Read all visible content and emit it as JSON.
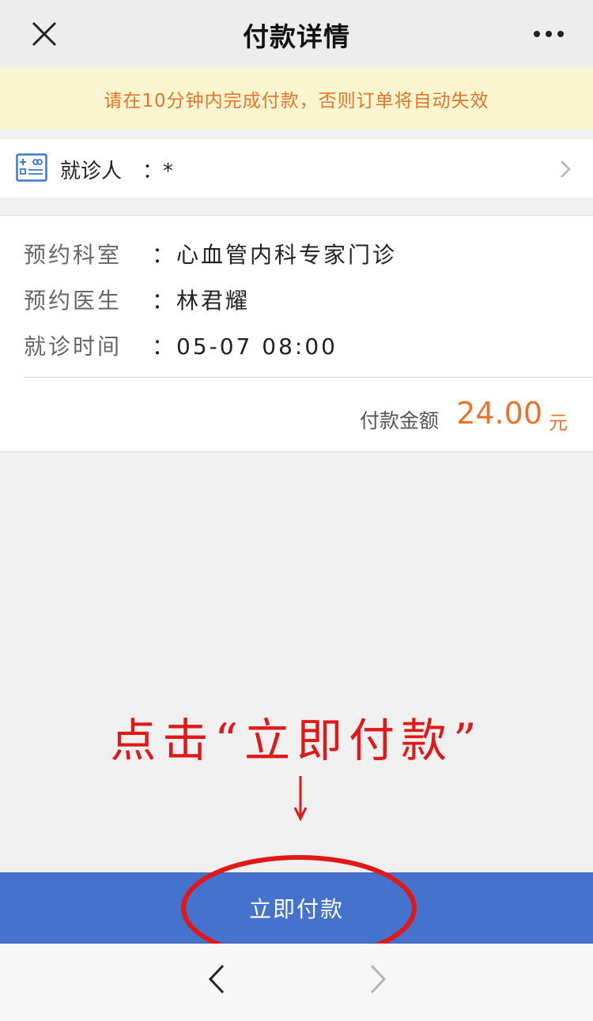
{
  "nav": {
    "title": "付款详情"
  },
  "notice": {
    "text": "请在10分钟内完成付款，否则订单将自动失效"
  },
  "patient": {
    "label": "就诊人",
    "value": "：*"
  },
  "appointment": {
    "rows": [
      {
        "label": "预约科室",
        "value": "：心血管内科专家门诊"
      },
      {
        "label": "预约医生",
        "value": "：林君耀"
      },
      {
        "label": "就诊时间",
        "value": "：05-07 08:00"
      }
    ],
    "amount_label": "付款金额",
    "amount_value": "24.00",
    "amount_unit": "元"
  },
  "annotation": {
    "text": "点击“立即付款”"
  },
  "pay_button": {
    "label": "立即付款"
  },
  "colors": {
    "accent_orange": "#e8742c",
    "button_blue": "#4472cc",
    "annotation_red": "#e01818",
    "notice_bg": "#fbf6cf"
  },
  "icons": [
    "close-icon",
    "more-icon",
    "patient-card-icon",
    "chevron-right-icon",
    "arrow-down-icon",
    "back-icon",
    "forward-icon"
  ]
}
